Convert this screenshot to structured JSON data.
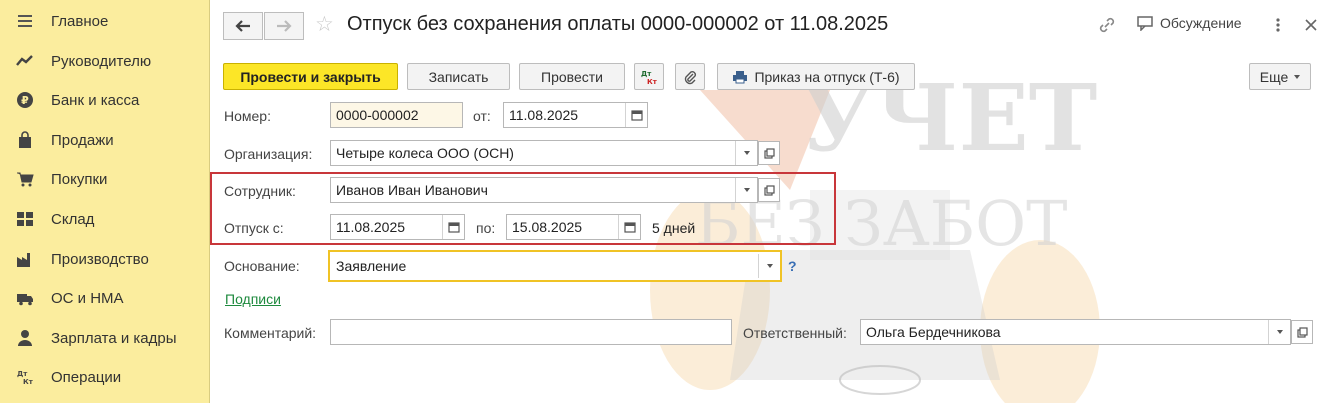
{
  "sidebar": {
    "items": [
      {
        "icon": "menu-icon",
        "label": "Главное"
      },
      {
        "icon": "chart-trend-icon",
        "label": "Руководителю"
      },
      {
        "icon": "ruble-coin-icon",
        "label": "Банк и касса"
      },
      {
        "icon": "shopping-bag-icon",
        "label": "Продажи"
      },
      {
        "icon": "cart-icon",
        "label": "Покупки"
      },
      {
        "icon": "warehouse-grid-icon",
        "label": "Склад"
      },
      {
        "icon": "factory-icon",
        "label": "Производство"
      },
      {
        "icon": "truck-icon",
        "label": "ОС и НМА"
      },
      {
        "icon": "person-icon",
        "label": "Зарплата и кадры"
      },
      {
        "icon": "dt-kt-icon",
        "label": "Операции"
      }
    ]
  },
  "header": {
    "title": "Отпуск без сохранения оплаты 0000-000002 от 11.08.2025",
    "discussion_label": "Обсуждение"
  },
  "toolbar": {
    "post_close_label": "Провести и закрыть",
    "save_label": "Записать",
    "post_label": "Провести",
    "dt_kt_label": "Дт Кт",
    "print_label": "Приказ на отпуск (Т-6)",
    "more_label": "Еще"
  },
  "form": {
    "number_label": "Номер:",
    "number_value": "0000-000002",
    "date_label": "от:",
    "date_value": "11.08.2025",
    "org_label": "Организация:",
    "org_value": "Четыре колеса ООО (ОСН)",
    "employee_label": "Сотрудник:",
    "employee_value": "Иванов Иван Иванович",
    "vacation_from_label": "Отпуск с:",
    "vacation_from_value": "11.08.2025",
    "vacation_to_label": "по:",
    "vacation_to_value": "15.08.2025",
    "days_text": "5 дней",
    "basis_label": "Основание:",
    "basis_value": "Заявление",
    "help_mark": "?",
    "signatures_link": "Подписи",
    "comment_label": "Комментарий:",
    "comment_value": "",
    "responsible_label": "Ответственный:",
    "responsible_value": "Ольга Бердечникова"
  },
  "watermark": {
    "line1": "УЧЕТ",
    "line2": "БЕЗ ЗАБОТ"
  },
  "colors": {
    "sidebar_bg": "#fbed9e",
    "primary_button": "#fce627",
    "highlight_border": "#c8363a",
    "link": "#1e8a3e",
    "focus_border": "#f0c325"
  }
}
